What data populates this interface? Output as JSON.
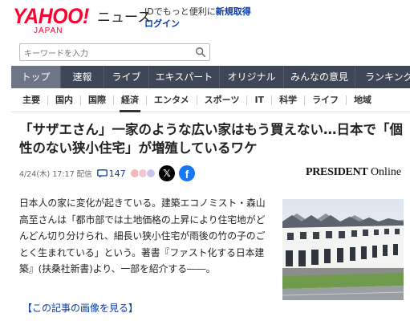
{
  "header": {
    "logo_text": "YAHOO!",
    "logo_sub": "JAPAN",
    "service": "ニュース",
    "id_promo_prefix": "IDでもっと便利に",
    "signup_link": "新規取得",
    "login_link": "ログイン"
  },
  "search": {
    "placeholder": "キーワードを入力",
    "icon": "search-icon"
  },
  "main_nav": {
    "tabs": [
      {
        "label": "トップ",
        "active": true
      },
      {
        "label": "速報",
        "active": false
      },
      {
        "label": "ライブ",
        "active": false
      },
      {
        "label": "エキスパート",
        "active": false
      },
      {
        "label": "オリジナル",
        "active": false
      },
      {
        "label": "みんなの意見",
        "active": false
      },
      {
        "label": "ランキング",
        "active": false
      }
    ]
  },
  "sub_nav": {
    "items": [
      {
        "label": "主要",
        "active": false
      },
      {
        "label": "国内",
        "active": false
      },
      {
        "label": "国際",
        "active": false
      },
      {
        "label": "経済",
        "active": true
      },
      {
        "label": "エンタメ",
        "active": false
      },
      {
        "label": "スポーツ",
        "active": false
      },
      {
        "label": "IT",
        "active": false
      },
      {
        "label": "科学",
        "active": false
      },
      {
        "label": "ライフ",
        "active": false
      },
      {
        "label": "地域",
        "active": false
      }
    ]
  },
  "article": {
    "title": "「サザエさん」一家のような広い家はもう買えない…日本で「個性のない狭小住宅」が増殖しているワケ",
    "date": "4/24(木) 17:17 配信",
    "comment_count": "147",
    "source_brand": "PRESIDENT",
    "source_sub": "Online",
    "lead": "日本人の家に変化が起きている。建築エコノミスト・森山高至さんは「都市部では土地価格の上昇により住宅地がどんどん切り分けられ、細長い狭小住宅が雨後の竹の子のごとく生まれている」という。著書『ファスト化する日本建築』(扶桑社新書)より、一部を紹介する――。",
    "image_link": "【この記事の画像を見る】"
  },
  "share": {
    "x_label": "𝕏",
    "fb_label": "f"
  },
  "colors": {
    "brand_red": "#ff0033",
    "nav_bg": "#3d4755",
    "nav_active": "#6c7684",
    "link_blue": "#0a3aa3",
    "facebook": "#1877f2"
  }
}
